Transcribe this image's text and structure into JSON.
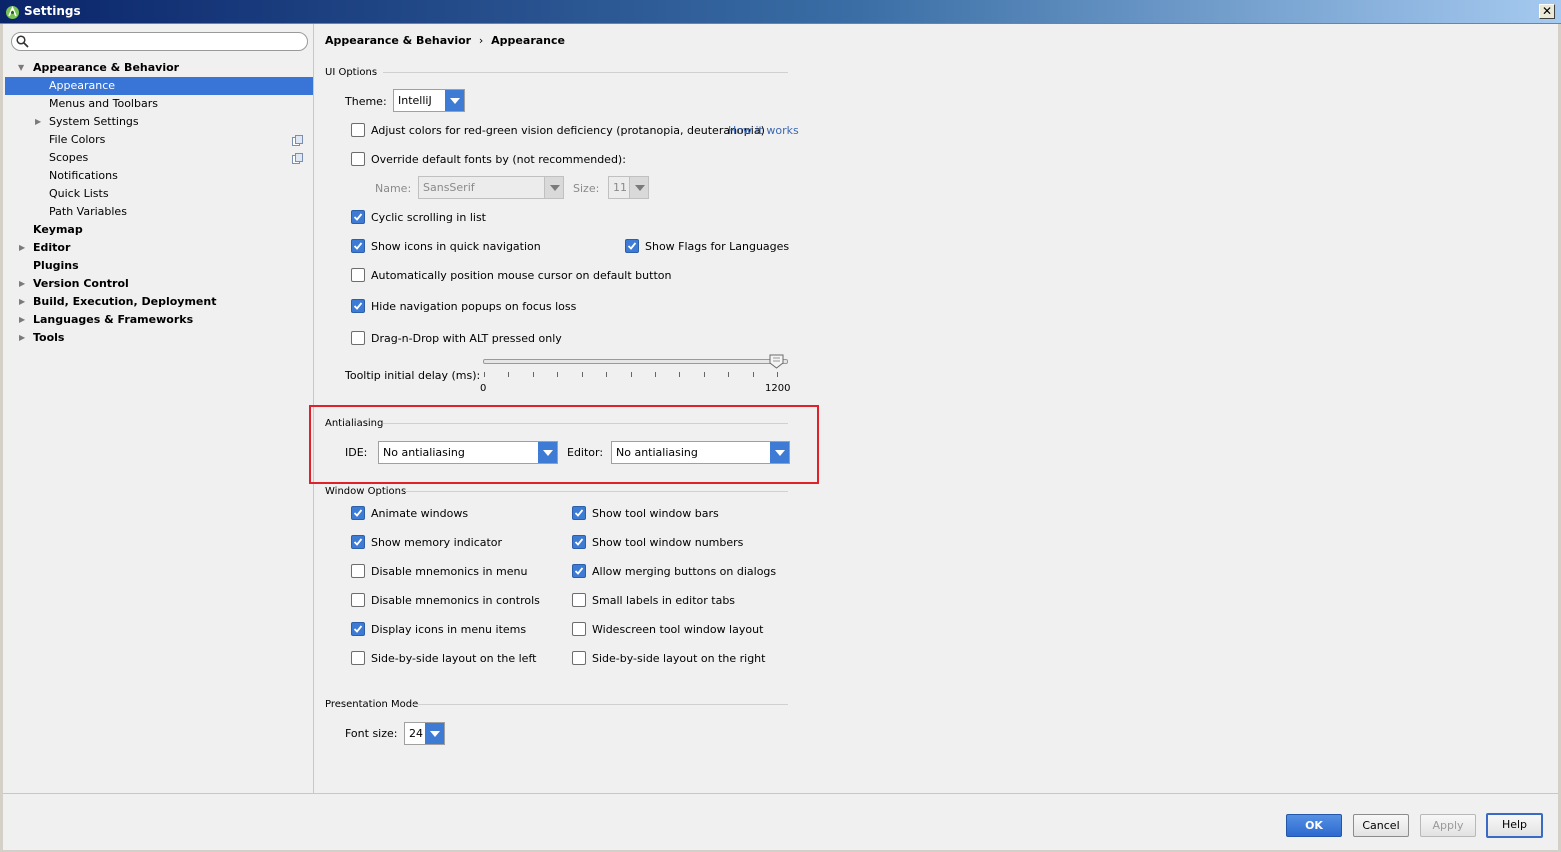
{
  "window": {
    "title": "Settings",
    "close_glyph": "✕"
  },
  "sidebar": {
    "search_placeholder": "",
    "items": [
      {
        "label": "Appearance & Behavior",
        "expanded": true
      },
      {
        "label": "Appearance",
        "selected": true
      },
      {
        "label": "Menus and Toolbars"
      },
      {
        "label": "System Settings"
      },
      {
        "label": "File Colors"
      },
      {
        "label": "Scopes"
      },
      {
        "label": "Notifications"
      },
      {
        "label": "Quick Lists"
      },
      {
        "label": "Path Variables"
      },
      {
        "label": "Keymap"
      },
      {
        "label": "Editor"
      },
      {
        "label": "Plugins"
      },
      {
        "label": "Version Control"
      },
      {
        "label": "Build, Execution, Deployment"
      },
      {
        "label": "Languages & Frameworks"
      },
      {
        "label": "Tools"
      }
    ]
  },
  "breadcrumb": {
    "parent": "Appearance & Behavior",
    "separator": "›",
    "current": "Appearance"
  },
  "ui_options": {
    "title": "UI Options",
    "theme_label": "Theme:",
    "theme_value": "IntelliJ",
    "adjust_colors": {
      "label": "Adjust colors for red-green vision deficiency (protanopia, deuteranopia)",
      "checked": false
    },
    "how_it_works": "How it works",
    "override_fonts": {
      "label": "Override default fonts by (not recommended):",
      "checked": false
    },
    "name_label": "Name:",
    "name_value": "SansSerif",
    "size_label": "Size:",
    "size_value": "11",
    "cyclic_scrolling": {
      "label": "Cyclic scrolling in list",
      "checked": true
    },
    "show_icons_nav": {
      "label": "Show icons in quick navigation",
      "checked": true
    },
    "show_flags": {
      "label": "Show Flags for Languages",
      "checked": true
    },
    "auto_position": {
      "label": "Automatically position mouse cursor on default button",
      "checked": false
    },
    "hide_nav_popups": {
      "label": "Hide navigation popups on focus loss",
      "checked": true
    },
    "drag_n_drop": {
      "label": "Drag-n-Drop with ALT pressed only",
      "checked": false
    },
    "tooltip_label": "Tooltip initial delay (ms):",
    "tooltip_min": "0",
    "tooltip_max": "1200",
    "tooltip_value": 1200
  },
  "antialiasing": {
    "title": "Antialiasing",
    "ide_label": "IDE:",
    "ide_value": "No antialiasing",
    "editor_label": "Editor:",
    "editor_value": "No antialiasing"
  },
  "window_options": {
    "title": "Window Options",
    "left": [
      {
        "label": "Animate windows",
        "checked": true
      },
      {
        "label": "Show memory indicator",
        "checked": true
      },
      {
        "label": "Disable mnemonics in menu",
        "checked": false
      },
      {
        "label": "Disable mnemonics in controls",
        "checked": false
      },
      {
        "label": "Display icons in menu items",
        "checked": true
      },
      {
        "label": "Side-by-side layout on the left",
        "checked": false
      }
    ],
    "right": [
      {
        "label": "Show tool window bars",
        "checked": true
      },
      {
        "label": "Show tool window numbers",
        "checked": true
      },
      {
        "label": "Allow merging buttons on dialogs",
        "checked": true
      },
      {
        "label": "Small labels in editor tabs",
        "checked": false
      },
      {
        "label": "Widescreen tool window layout",
        "checked": false
      },
      {
        "label": "Side-by-side layout on the right",
        "checked": false
      }
    ]
  },
  "presentation_mode": {
    "title": "Presentation Mode",
    "font_size_label": "Font size:",
    "font_size_value": "24"
  },
  "footer": {
    "ok": "OK",
    "cancel": "Cancel",
    "apply": "Apply",
    "help": "Help"
  },
  "colors": {
    "accent": "#3875d7",
    "highlight_border": "#e0202a",
    "link": "#3b68b2"
  }
}
